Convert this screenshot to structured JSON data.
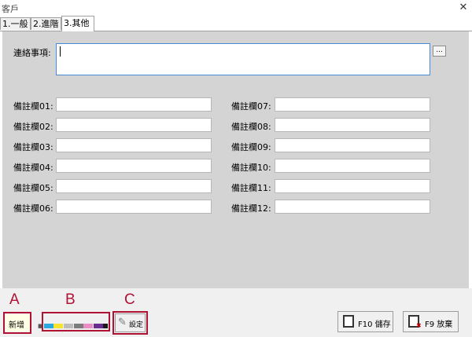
{
  "window": {
    "title": "客戶",
    "close_icon": "close-icon"
  },
  "tabs": [
    {
      "label": "1.一般"
    },
    {
      "label": "2.進階"
    },
    {
      "label": "3.其他",
      "active": true
    }
  ],
  "contact": {
    "label": "連絡事項:",
    "value": "",
    "ellipsis_label": "..."
  },
  "remarks_left": [
    {
      "label": "備註欄01:",
      "value": ""
    },
    {
      "label": "備註欄02:",
      "value": ""
    },
    {
      "label": "備註欄03:",
      "value": ""
    },
    {
      "label": "備註欄04:",
      "value": ""
    },
    {
      "label": "備註欄05:",
      "value": ""
    },
    {
      "label": "備註欄06:",
      "value": ""
    }
  ],
  "remarks_right": [
    {
      "label": "備註欄07:",
      "value": ""
    },
    {
      "label": "備註欄08:",
      "value": ""
    },
    {
      "label": "備註欄09:",
      "value": ""
    },
    {
      "label": "備註欄10:",
      "value": ""
    },
    {
      "label": "備註欄11:",
      "value": ""
    },
    {
      "label": "備註欄12:",
      "value": ""
    }
  ],
  "bottom": {
    "new_label": "新增",
    "settings_label": "設定",
    "save_label": "F10 儲存",
    "discard_label": "F9 放棄",
    "colors": [
      "#29a9e0",
      "#f7e430",
      "#bcbcbc",
      "#7c7c7c",
      "#e88ec4",
      "#d23a8e",
      "#6b2c91",
      "#1a1a1a"
    ]
  },
  "annotations": {
    "a": "A",
    "b": "B",
    "c": "C",
    "color": "#b01233"
  }
}
